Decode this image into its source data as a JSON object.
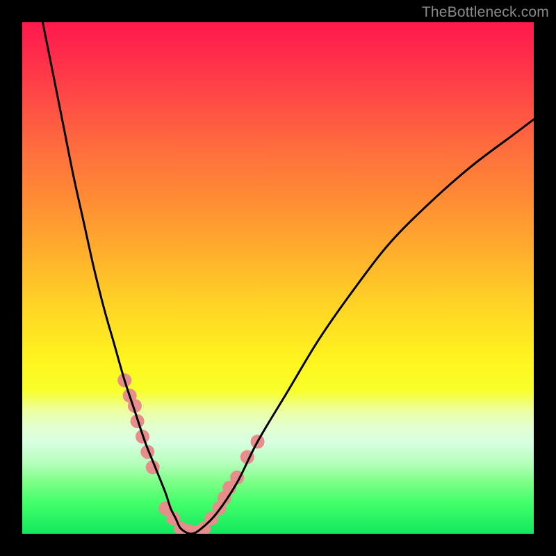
{
  "watermark": "TheBottleneck.com",
  "chart_data": {
    "type": "line",
    "title": "",
    "xlabel": "",
    "ylabel": "",
    "xlim": [
      0,
      100
    ],
    "ylim": [
      0,
      100
    ],
    "grid": false,
    "series": [
      {
        "name": "bottleneck-curve",
        "x": [
          4,
          6,
          8,
          10,
          12,
          14,
          16,
          18,
          20,
          22,
          24,
          26,
          28,
          29,
          30,
          31,
          33,
          35,
          38,
          42,
          46,
          52,
          58,
          65,
          72,
          80,
          88,
          96,
          100
        ],
        "y": [
          100,
          90,
          80,
          70,
          61,
          52,
          44,
          37,
          30,
          24,
          18,
          13,
          8,
          5,
          3,
          1,
          0,
          1,
          4,
          10,
          18,
          28,
          38,
          48,
          57,
          65,
          72,
          78,
          81
        ]
      }
    ],
    "markers": [
      {
        "name": "cluster-left",
        "points": [
          {
            "x": 20,
            "y": 30
          },
          {
            "x": 21,
            "y": 27
          },
          {
            "x": 22,
            "y": 25
          },
          {
            "x": 22.5,
            "y": 22
          },
          {
            "x": 23.5,
            "y": 19
          },
          {
            "x": 24.5,
            "y": 16
          },
          {
            "x": 25.5,
            "y": 13
          }
        ]
      },
      {
        "name": "cluster-right",
        "points": [
          {
            "x": 37,
            "y": 3
          },
          {
            "x": 38.5,
            "y": 5
          },
          {
            "x": 39.5,
            "y": 7
          },
          {
            "x": 40.5,
            "y": 9
          },
          {
            "x": 42,
            "y": 11
          },
          {
            "x": 44,
            "y": 15
          },
          {
            "x": 46,
            "y": 18
          }
        ]
      },
      {
        "name": "cluster-bottom",
        "points": [
          {
            "x": 28,
            "y": 5
          },
          {
            "x": 29.5,
            "y": 3
          },
          {
            "x": 31,
            "y": 1
          },
          {
            "x": 32.5,
            "y": 0.5
          },
          {
            "x": 34,
            "y": 0.3
          },
          {
            "x": 35.5,
            "y": 1
          }
        ]
      }
    ],
    "style": {
      "curve_color": "#000000",
      "curve_width": 3,
      "marker_fill": "#e78d8b",
      "marker_radius": 10
    }
  }
}
